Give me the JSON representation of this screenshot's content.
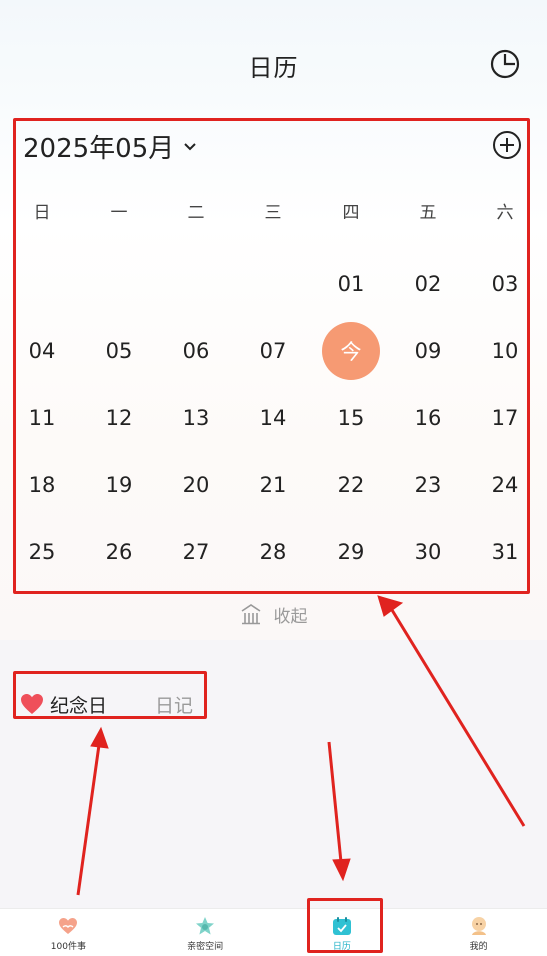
{
  "header": {
    "title": "日历",
    "stats_icon": "pie-chart-icon"
  },
  "calendar": {
    "month_label": "2025年05月",
    "weekdays": [
      "日",
      "一",
      "二",
      "三",
      "四",
      "五",
      "六"
    ],
    "weeks": [
      [
        "",
        "",
        "",
        "",
        "01",
        "02",
        "03"
      ],
      [
        "04",
        "05",
        "06",
        "07",
        "今",
        "09",
        "10"
      ],
      [
        "11",
        "12",
        "13",
        "14",
        "15",
        "16",
        "17"
      ],
      [
        "18",
        "19",
        "20",
        "21",
        "22",
        "23",
        "24"
      ],
      [
        "25",
        "26",
        "27",
        "28",
        "29",
        "30",
        "31"
      ]
    ],
    "today_label": "今",
    "collapse_label": "收起"
  },
  "tabs": {
    "active": "纪念日",
    "inactive": "日记"
  },
  "bottom_nav": [
    {
      "label": "100件事",
      "icon": "heart-hands-icon",
      "active": false
    },
    {
      "label": "亲密空间",
      "icon": "star-icon",
      "active": false
    },
    {
      "label": "日历",
      "icon": "calendar-icon",
      "active": true
    },
    {
      "label": "我的",
      "icon": "avatar-icon",
      "active": false
    }
  ],
  "colors": {
    "today": "#f69a73",
    "annotation": "#e0231f",
    "accent": "#1fb1c6"
  }
}
